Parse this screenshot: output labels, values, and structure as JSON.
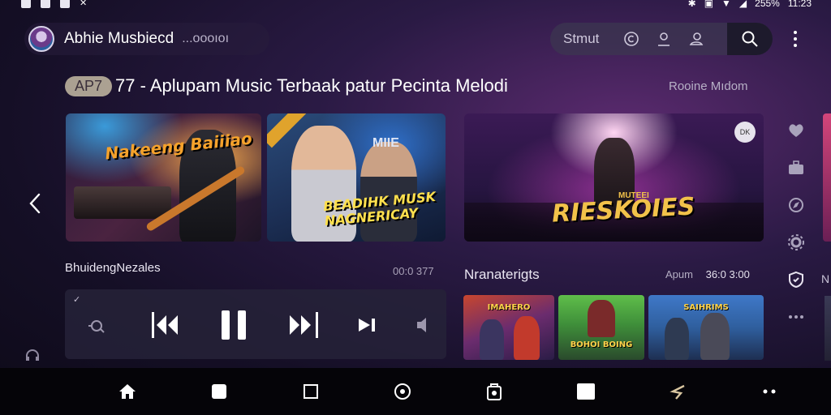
{
  "status_bar": {
    "left_icons": [
      "notification-square-icon",
      "notification-mail-icon",
      "notification-upload-icon",
      "notification-x-icon"
    ],
    "battery": "255%",
    "time": "11:23"
  },
  "header": {
    "app_name": "Abhie Musbiecd",
    "app_sub": "...oooıoı",
    "search_label": "Stmut",
    "icons": [
      "copyright-icon",
      "user-icon",
      "profile-alt-icon",
      "search-icon",
      "more-vertical-icon"
    ]
  },
  "page": {
    "title_badge": "AP7",
    "title": "77 - Aplupam Music Terbaak patur Pecinta Melodi",
    "title_link": "Rooine Mıdom"
  },
  "banners": [
    {
      "text": "Nakeeng Baiiiao"
    },
    {
      "tag": "",
      "text_line1": "BEADIHK MUSK",
      "text_line2": "NAGNERICAY",
      "overlay": "MIIE"
    },
    {
      "small": "MUTEEI",
      "text": "RIESKOIES",
      "badge": "DK"
    }
  ],
  "now_playing": {
    "title": "BhuidengNezales",
    "time": "00:0 377",
    "note": "✓"
  },
  "trending": {
    "title": "Nranaterigts",
    "meta_label": "Apum",
    "meta_time": "36:0 3:00",
    "thumbs": [
      {
        "text": "IMAHERO"
      },
      {
        "text": "BOHOI BOING"
      },
      {
        "text": "SAIHRIMS"
      }
    ]
  },
  "side": {
    "edge_label": "N"
  },
  "colors": {
    "background": "#150f26",
    "accent": "#f2c24a",
    "nav_bg": "#050408"
  }
}
